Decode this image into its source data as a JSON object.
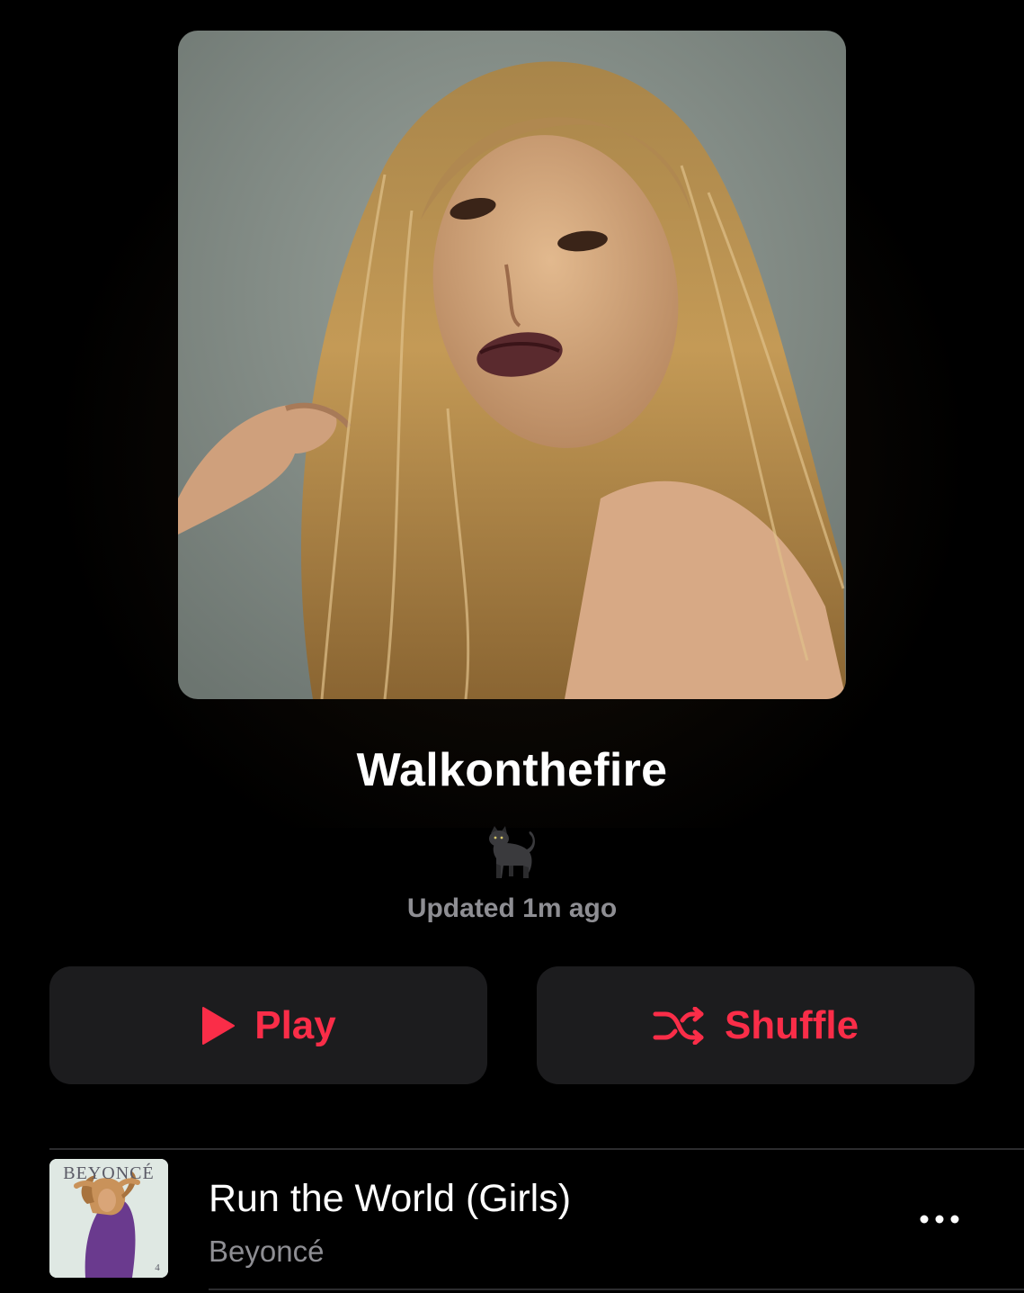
{
  "playlist": {
    "title": "Walkonthefire",
    "description_emoji": "🐈‍⬛",
    "updated_text": "Updated 1m ago"
  },
  "actions": {
    "play_label": "Play",
    "play_icon": "play-icon",
    "shuffle_label": "Shuffle",
    "shuffle_icon": "shuffle-icon"
  },
  "tracks": [
    {
      "title": "Run the World (Girls)",
      "artist": "Beyoncé",
      "artwork_text": "BEYONCÉ",
      "artwork_number": "4"
    }
  ],
  "colors": {
    "accent": "#fa2d48",
    "background": "#000000",
    "button_bg": "#1c1c1e",
    "secondary_text": "#8e8e93"
  }
}
